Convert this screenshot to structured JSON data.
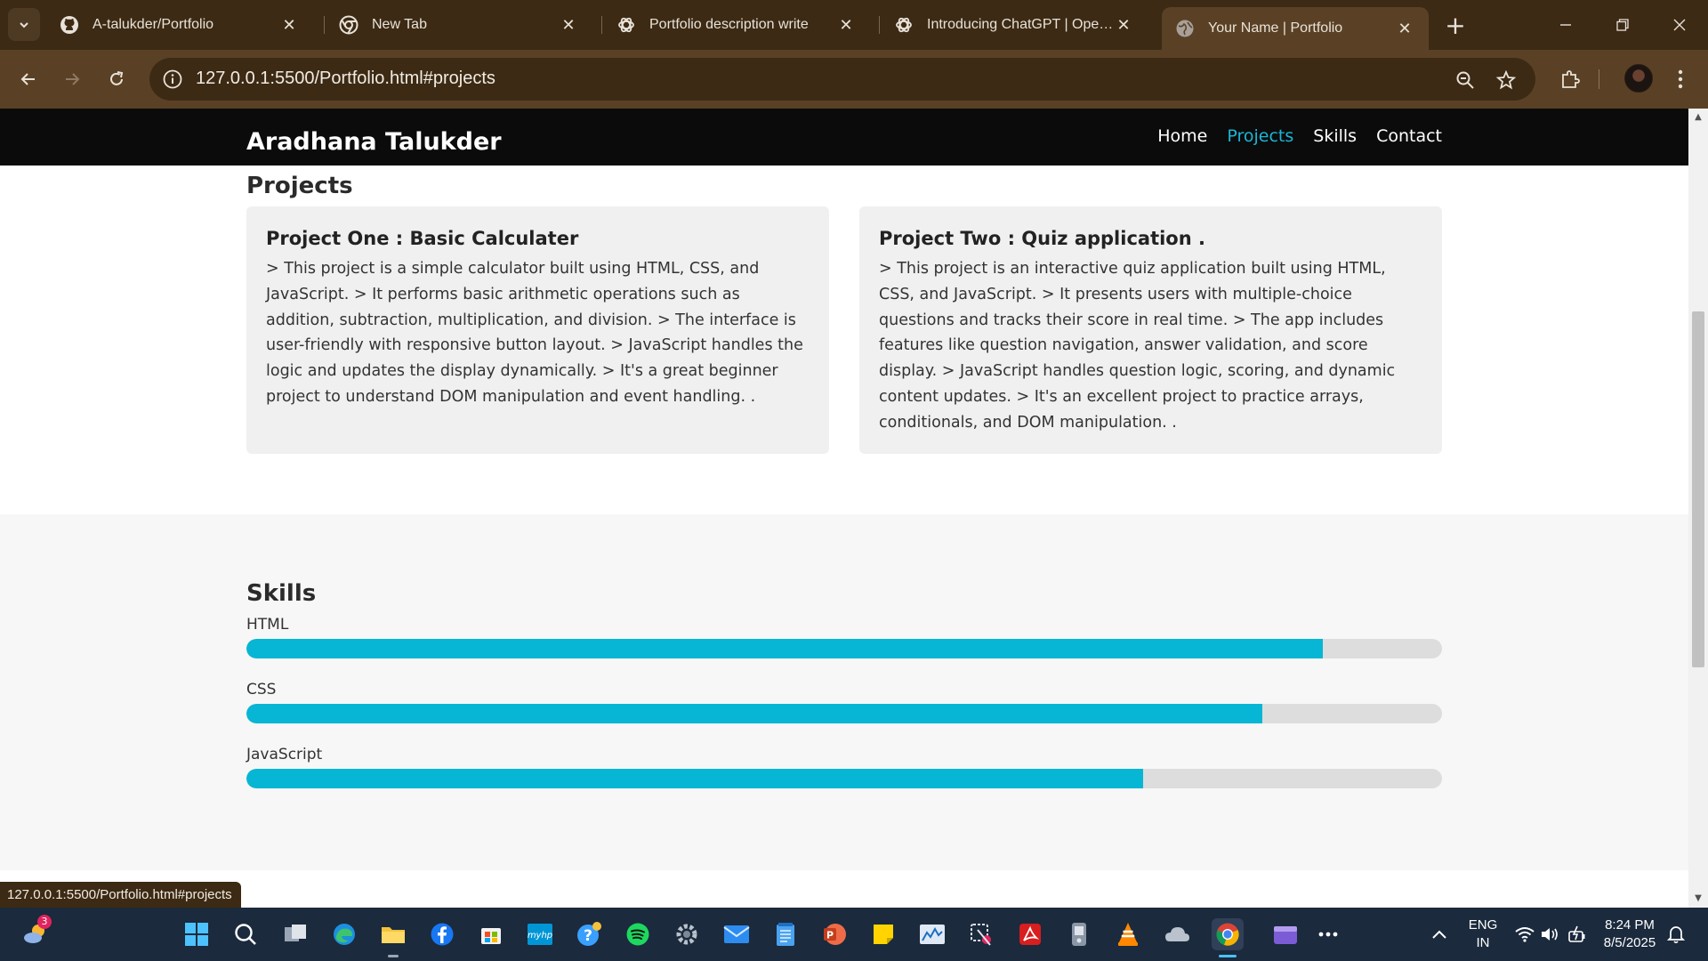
{
  "browser": {
    "tabs": [
      {
        "title": "A-talukder/Portfolio",
        "icon": "github-icon",
        "active": false
      },
      {
        "title": "New Tab",
        "icon": "chrome-icon",
        "active": false
      },
      {
        "title": "Portfolio description write",
        "icon": "openai-icon",
        "active": false
      },
      {
        "title": "Introducing ChatGPT | OpenAI",
        "icon": "openai-icon",
        "active": false
      },
      {
        "title": "Your Name | Portfolio",
        "icon": "globe-icon",
        "active": true
      }
    ],
    "url": "127.0.0.1:5500/Portfolio.html#projects",
    "status_url": "127.0.0.1:5500/Portfolio.html#projects"
  },
  "site": {
    "logo": "Aradhana Talukder",
    "nav": [
      {
        "label": "Home",
        "active": false
      },
      {
        "label": "Projects",
        "active": true
      },
      {
        "label": "Skills",
        "active": false
      },
      {
        "label": "Contact",
        "active": false
      }
    ],
    "projects": {
      "title": "Projects",
      "items": [
        {
          "title": "Project One : Basic Calculater",
          "description": "> This project is a simple calculator built using HTML, CSS, and JavaScript. > It performs basic arithmetic operations such as addition, subtraction, multiplication, and division. > The interface is user-friendly with responsive button layout. > JavaScript handles the logic and updates the display dynamically. > It's a great beginner project to understand DOM manipulation and event handling. ."
        },
        {
          "title": "Project Two : Quiz application .",
          "description": "> This project is an interactive quiz application built using HTML, CSS, and JavaScript. > It presents users with multiple-choice questions and tracks their score in real time. > The app includes features like question navigation, answer validation, and score display. > JavaScript handles question logic, scoring, and dynamic content updates. > It's an excellent project to practice arrays, conditionals, and DOM manipulation. ."
        }
      ]
    },
    "skills": {
      "title": "Skills",
      "items": [
        {
          "label": "HTML",
          "level_percent": 90
        },
        {
          "label": "CSS",
          "level_percent": 85
        },
        {
          "label": "JavaScript",
          "level_percent": 75
        }
      ]
    }
  },
  "taskbar": {
    "language": "ENG",
    "region": "IN",
    "time": "8:24 PM",
    "date": "8/5/2025",
    "weather_badge": "3"
  },
  "colors": {
    "accent": "#06b6d4",
    "nav_active": "#1ab6d6",
    "header_bg": "#0b0b0b",
    "chrome_frame": "#3c2a14",
    "chrome_toolbar": "#5a4125"
  }
}
